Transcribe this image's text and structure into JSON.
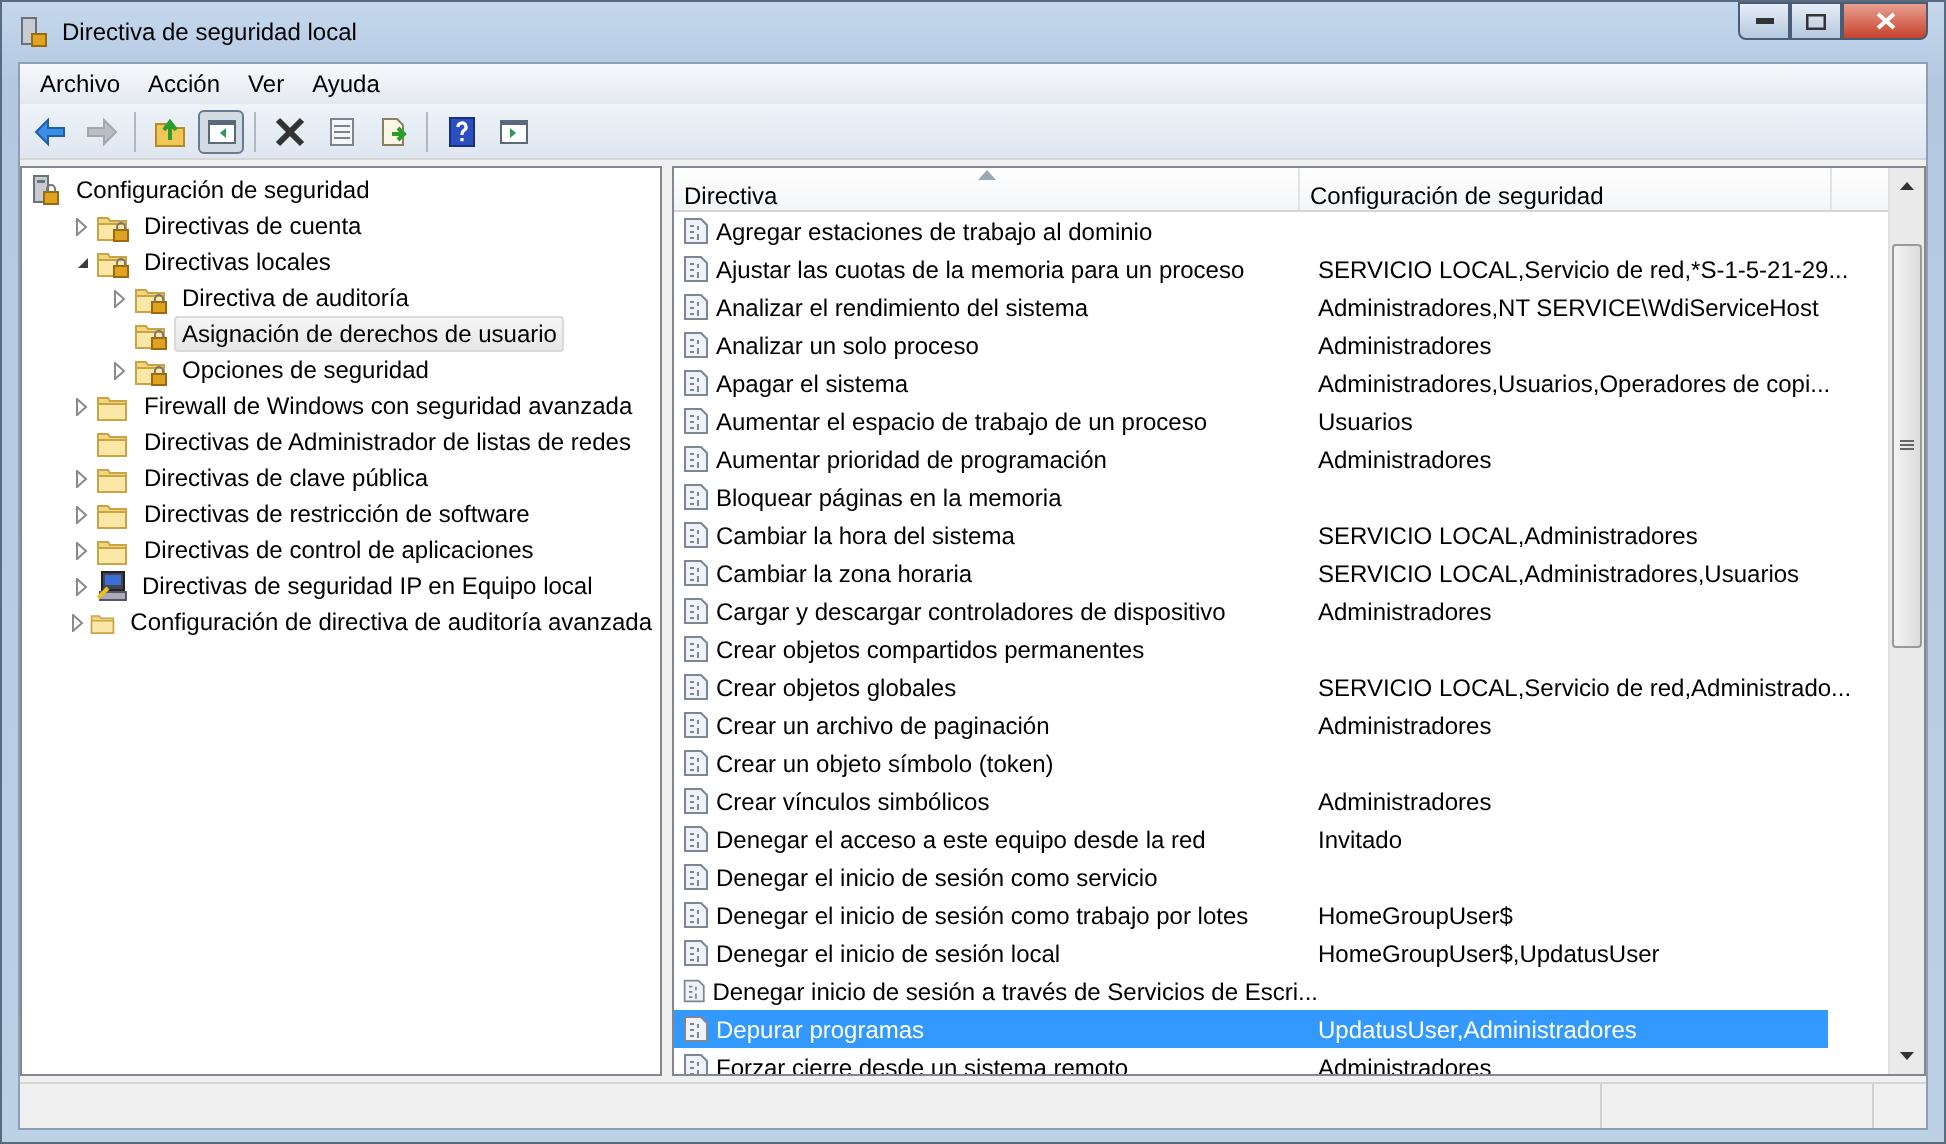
{
  "window": {
    "title": "Directiva de seguridad local"
  },
  "menu": [
    {
      "label": "Archivo"
    },
    {
      "label": "Acción"
    },
    {
      "label": "Ver"
    },
    {
      "label": "Ayuda"
    }
  ],
  "toolbar": [
    {
      "pressed": false,
      "disabled": false
    },
    {
      "pressed": false,
      "disabled": true
    },
    {
      "pressed": false,
      "disabled": false
    },
    {
      "pressed": true,
      "disabled": false
    },
    {
      "pressed": false,
      "disabled": false
    },
    {
      "pressed": false,
      "disabled": false
    },
    {
      "pressed": false,
      "disabled": false
    },
    {
      "pressed": false,
      "disabled": false
    },
    {
      "pressed": false,
      "disabled": false
    }
  ],
  "tree": [
    {
      "label": "Configuración de seguridad",
      "kind": "root",
      "selected": false,
      "children": [
        {
          "label": "Directivas de cuenta",
          "kind": "locked",
          "selected": false,
          "expanded": false
        },
        {
          "label": "Directivas locales",
          "kind": "locked",
          "selected": false,
          "expanded": true,
          "children": [
            {
              "label": "Directiva de auditoría",
              "kind": "locked",
              "selected": false,
              "expanded": false
            },
            {
              "label": "Asignación de derechos de usuario",
              "kind": "locked",
              "selected": true
            },
            {
              "label": "Opciones de seguridad",
              "kind": "locked",
              "selected": false,
              "expanded": false
            }
          ]
        },
        {
          "label": "Firewall de Windows con seguridad avanzada",
          "kind": "folder",
          "selected": false,
          "expanded": false
        },
        {
          "label": "Directivas de Administrador de listas de redes",
          "kind": "folder",
          "selected": false
        },
        {
          "label": "Directivas de clave pública",
          "kind": "folder",
          "selected": false,
          "expanded": false
        },
        {
          "label": "Directivas de restricción de software",
          "kind": "folder",
          "selected": false,
          "expanded": false
        },
        {
          "label": "Directivas de control de aplicaciones",
          "kind": "folder",
          "selected": false,
          "expanded": false
        },
        {
          "label": "Directivas de seguridad IP en Equipo local",
          "kind": "computer",
          "selected": false,
          "expanded": false
        },
        {
          "label": "Configuración de directiva de auditoría avanzada",
          "kind": "folder",
          "selected": false,
          "expanded": false
        }
      ]
    }
  ],
  "table": {
    "columns": [
      "Directiva",
      "Configuración de seguridad"
    ],
    "rows": [
      {
        "policy": "Agregar estaciones de trabajo al dominio",
        "selected": false
      },
      {
        "policy": "Ajustar las cuotas de la memoria para un proceso",
        "setting": "SERVICIO LOCAL,Servicio de red,*S-1-5-21-29...",
        "selected": false
      },
      {
        "policy": "Analizar el rendimiento del sistema",
        "setting": "Administradores,NT SERVICE\\WdiServiceHost",
        "selected": false
      },
      {
        "policy": "Analizar un solo proceso",
        "setting": "Administradores",
        "selected": false
      },
      {
        "policy": "Apagar el sistema",
        "setting": "Administradores,Usuarios,Operadores de copi...",
        "selected": false
      },
      {
        "policy": "Aumentar el espacio de trabajo de un proceso",
        "setting": "Usuarios",
        "selected": false
      },
      {
        "policy": "Aumentar prioridad de programación",
        "setting": "Administradores",
        "selected": false
      },
      {
        "policy": "Bloquear páginas en la memoria",
        "selected": false
      },
      {
        "policy": "Cambiar la hora del sistema",
        "setting": "SERVICIO LOCAL,Administradores",
        "selected": false
      },
      {
        "policy": "Cambiar la zona horaria",
        "setting": "SERVICIO LOCAL,Administradores,Usuarios",
        "selected": false
      },
      {
        "policy": "Cargar y descargar controladores de dispositivo",
        "setting": "Administradores",
        "selected": false
      },
      {
        "policy": "Crear objetos compartidos permanentes",
        "selected": false
      },
      {
        "policy": "Crear objetos globales",
        "setting": "SERVICIO LOCAL,Servicio de red,Administrado...",
        "selected": false
      },
      {
        "policy": "Crear un archivo de paginación",
        "setting": "Administradores",
        "selected": false
      },
      {
        "policy": "Crear un objeto símbolo (token)",
        "selected": false
      },
      {
        "policy": "Crear vínculos simbólicos",
        "setting": "Administradores",
        "selected": false
      },
      {
        "policy": "Denegar el acceso a este equipo desde la red",
        "setting": "Invitado",
        "selected": false
      },
      {
        "policy": "Denegar el inicio de sesión como servicio",
        "selected": false
      },
      {
        "policy": "Denegar el inicio de sesión como trabajo por lotes",
        "setting": "HomeGroupUser$",
        "selected": false
      },
      {
        "policy": "Denegar el inicio de sesión local",
        "setting": "HomeGroupUser$,UpdatusUser",
        "selected": false
      },
      {
        "policy": "Denegar inicio de sesión a través de Servicios de Escri...",
        "selected": false
      },
      {
        "policy": "Depurar programas",
        "setting": "UpdatusUser,Administradores",
        "selected": true
      },
      {
        "policy": "Forzar cierre desde un sistema remoto",
        "setting": "Administradores",
        "selected": false
      }
    ]
  }
}
